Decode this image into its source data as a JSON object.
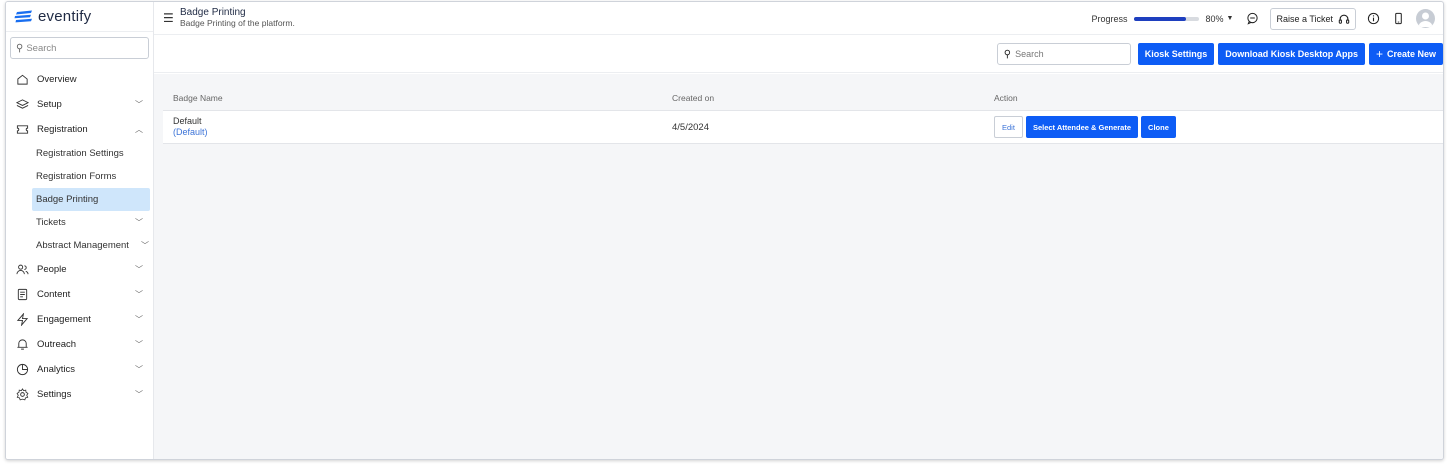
{
  "app": {
    "logo_text": "eventify"
  },
  "sidebar": {
    "search_placeholder": "Search",
    "items": [
      {
        "label": "Overview",
        "icon": "home-icon"
      },
      {
        "label": "Setup",
        "icon": "layers-icon"
      },
      {
        "label": "Registration",
        "icon": "ticket-icon"
      },
      {
        "label": "People",
        "icon": "people-icon"
      },
      {
        "label": "Content",
        "icon": "document-icon"
      },
      {
        "label": "Engagement",
        "icon": "lightning-icon"
      },
      {
        "label": "Outreach",
        "icon": "bell-icon"
      },
      {
        "label": "Analytics",
        "icon": "pie-chart-icon"
      },
      {
        "label": "Settings",
        "icon": "gear-icon"
      }
    ],
    "registration_sub": [
      {
        "label": "Registration Settings"
      },
      {
        "label": "Registration Forms"
      },
      {
        "label": "Badge Printing"
      },
      {
        "label": "Tickets"
      },
      {
        "label": "Abstract Management"
      }
    ]
  },
  "header": {
    "title": "Badge Printing",
    "subtitle": "Badge Printing of the platform.",
    "progress_label": "Progress",
    "progress_value": "80%",
    "progress_fraction": 0.8,
    "raise_ticket": "Raise a Ticket"
  },
  "toolbar": {
    "search_placeholder": "Search",
    "kiosk_settings": "Kiosk Settings",
    "download_apps": "Download Kiosk Desktop Apps",
    "create_new": "Create New"
  },
  "table": {
    "columns": [
      "Badge Name",
      "Created on",
      "Action"
    ],
    "rows": [
      {
        "name": "Default",
        "tag": "(Default)",
        "created": "4/5/2024",
        "actions": [
          "Edit",
          "Select Attendee & Generate",
          "Clone"
        ]
      }
    ]
  },
  "colors": {
    "primary": "#0d5cf5",
    "active_bg": "#cfe6fb",
    "progress": "#1e3fbf"
  }
}
